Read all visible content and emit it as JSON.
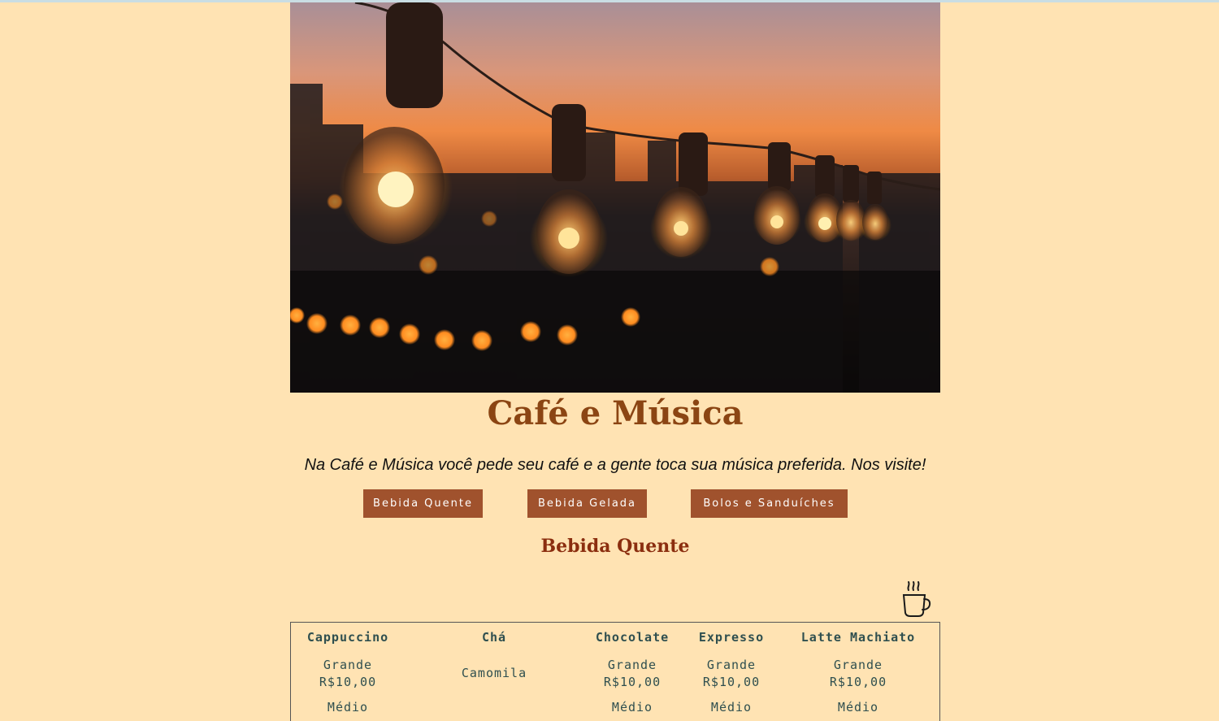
{
  "hero": {
    "image_alt": "string-lights-sunset-photo"
  },
  "header": {
    "title": "Café e Música",
    "tagline": "Na Café e Música você pede seu café e a gente toca sua música preferida. Nos visite!"
  },
  "nav": {
    "buttons": [
      {
        "label": "Bebida Quente"
      },
      {
        "label": "Bebida Gelada"
      },
      {
        "label": "Bolos e Sanduíches"
      }
    ]
  },
  "section": {
    "heading": "Bebida Quente",
    "icon": "coffee-cup-icon"
  },
  "menu": {
    "columns": [
      {
        "name": "Cappuccino",
        "rows": [
          {
            "size": "Grande",
            "price": "R$10,00"
          },
          {
            "size": "Médio",
            "price": ""
          }
        ]
      },
      {
        "name": "Chá",
        "items": [
          "Camomila"
        ]
      },
      {
        "name": "Chocolate",
        "rows": [
          {
            "size": "Grande",
            "price": "R$10,00"
          },
          {
            "size": "Médio",
            "price": ""
          }
        ]
      },
      {
        "name": "Expresso",
        "rows": [
          {
            "size": "Grande",
            "price": "R$10,00"
          },
          {
            "size": "Médio",
            "price": ""
          }
        ]
      },
      {
        "name": "Latte Machiato",
        "rows": [
          {
            "size": "Grande",
            "price": "R$10,00"
          },
          {
            "size": "Médio",
            "price": ""
          }
        ]
      }
    ]
  },
  "colors": {
    "background": "#ffe3b3",
    "title": "#8b4513",
    "button": "#a0522d",
    "section_heading": "#8b2e0f",
    "table_text": "#2f4f4f"
  }
}
